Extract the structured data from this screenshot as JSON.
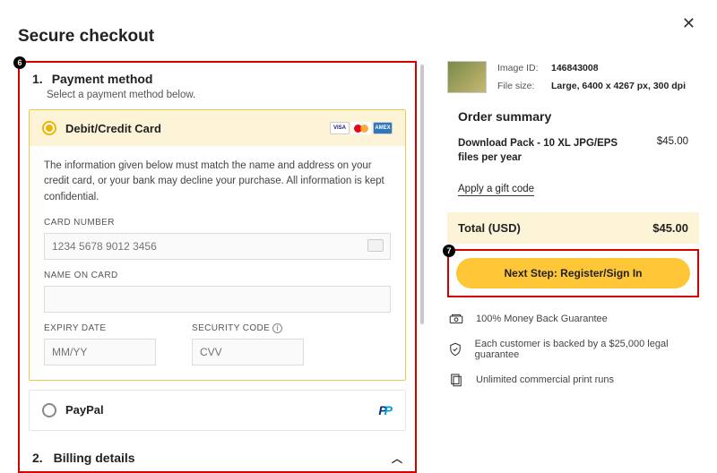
{
  "title": "Secure checkout",
  "annotations": {
    "badge_left": "6",
    "badge_right": "7"
  },
  "payment": {
    "section_number": "1.",
    "section_title": "Payment method",
    "subtitle": "Select a payment method below.",
    "card_option_label": "Debit/Credit Card",
    "info_text": "The information given below must match the name and address on your credit card, or your bank may decline your purchase. All information is kept confidential.",
    "card_number_label": "CARD NUMBER",
    "card_number_placeholder": "1234 5678 9012 3456",
    "name_label": "NAME ON CARD",
    "expiry_label": "EXPIRY DATE",
    "expiry_placeholder": "MM/YY",
    "cvv_label": "SECURITY CODE",
    "cvv_placeholder": "CVV",
    "paypal_label": "PayPal",
    "cc_brands": {
      "visa": "VISA",
      "amex": "AMEX"
    }
  },
  "billing": {
    "section_number": "2.",
    "section_title": "Billing details"
  },
  "meta": {
    "image_id_label": "Image ID:",
    "image_id": "146843008",
    "file_size_label": "File size:",
    "file_size": "Large, 6400 x 4267 px, 300 dpi"
  },
  "order": {
    "title": "Order summary",
    "item_desc": "Download Pack - 10 XL JPG/EPS files per year",
    "item_price": "$45.00",
    "gift_link": "Apply a gift code",
    "total_label": "Total (USD)",
    "total_value": "$45.00",
    "next_button": "Next Step: Register/Sign In"
  },
  "guarantees": {
    "g1": "100% Money Back Guarantee",
    "g2": "Each customer is backed by a $25,000 legal guarantee",
    "g3": "Unlimited commercial print runs"
  }
}
